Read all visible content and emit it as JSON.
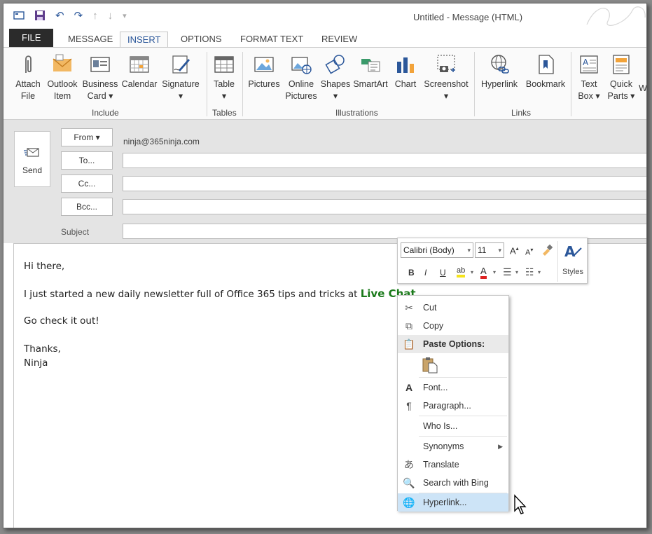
{
  "window": {
    "title": "Untitled - Message (HTML)"
  },
  "qat": {
    "save_icon": "save-icon",
    "undo_icon": "undo-icon",
    "redo_icon": "redo-icon"
  },
  "tabs": [
    {
      "label": "FILE"
    },
    {
      "label": "MESSAGE"
    },
    {
      "label": "INSERT"
    },
    {
      "label": "OPTIONS"
    },
    {
      "label": "FORMAT TEXT"
    },
    {
      "label": "REVIEW"
    }
  ],
  "ribbon": {
    "include": {
      "group_label": "Include",
      "attach_file": [
        "Attach",
        "File"
      ],
      "outlook_item": [
        "Outlook",
        "Item"
      ],
      "business_card": [
        "Business",
        "Card ▾"
      ],
      "calendar": "Calendar",
      "signature": [
        "Signature",
        "▾"
      ]
    },
    "tables": {
      "group_label": "Tables",
      "table": [
        "Table",
        "▾"
      ]
    },
    "illustrations": {
      "group_label": "Illustrations",
      "pictures": "Pictures",
      "online_pictures": [
        "Online",
        "Pictures"
      ],
      "shapes": [
        "Shapes",
        "▾"
      ],
      "smartart": "SmartArt",
      "chart": "Chart",
      "screenshot": [
        "Screenshot",
        "▾"
      ]
    },
    "links": {
      "group_label": "Links",
      "hyperlink": "Hyperlink",
      "bookmark": "Bookmark"
    },
    "text": {
      "text_box": [
        "Text",
        "Box ▾"
      ],
      "quick_parts": [
        "Quick",
        "Parts ▾"
      ],
      "cut_off": "W"
    }
  },
  "compose": {
    "send_label": "Send",
    "from_label": "From ▾",
    "from_address": "ninja@365ninja.com",
    "to_label": "To...",
    "cc_label": "Cc...",
    "bcc_label": "Bcc...",
    "subject_label": "Subject"
  },
  "body": {
    "line1": "Hi there,",
    "line2": "I just started a new daily newsletter full of Office 365 tips and tricks at",
    "selected_text": "Live Chat",
    "line3": "Go check it out!",
    "line4": "Thanks,",
    "line5": "Ninja"
  },
  "mini_toolbar": {
    "font": "Calibri (Body)",
    "size": "11",
    "styles_label": "Styles"
  },
  "context_menu": {
    "cut": "Cut",
    "copy": "Copy",
    "paste_options": "Paste Options:",
    "font": "Font...",
    "paragraph": "Paragraph...",
    "who_is": "Who Is...",
    "synonyms": "Synonyms",
    "translate": "Translate",
    "search_bing": "Search with Bing",
    "hyperlink": "Hyperlink..."
  },
  "colors": {
    "accent": "#2b579a",
    "file_tab": "#2b2b2b",
    "selection_text": "#1a7a1a",
    "menu_highlight": "#cde4f7"
  }
}
